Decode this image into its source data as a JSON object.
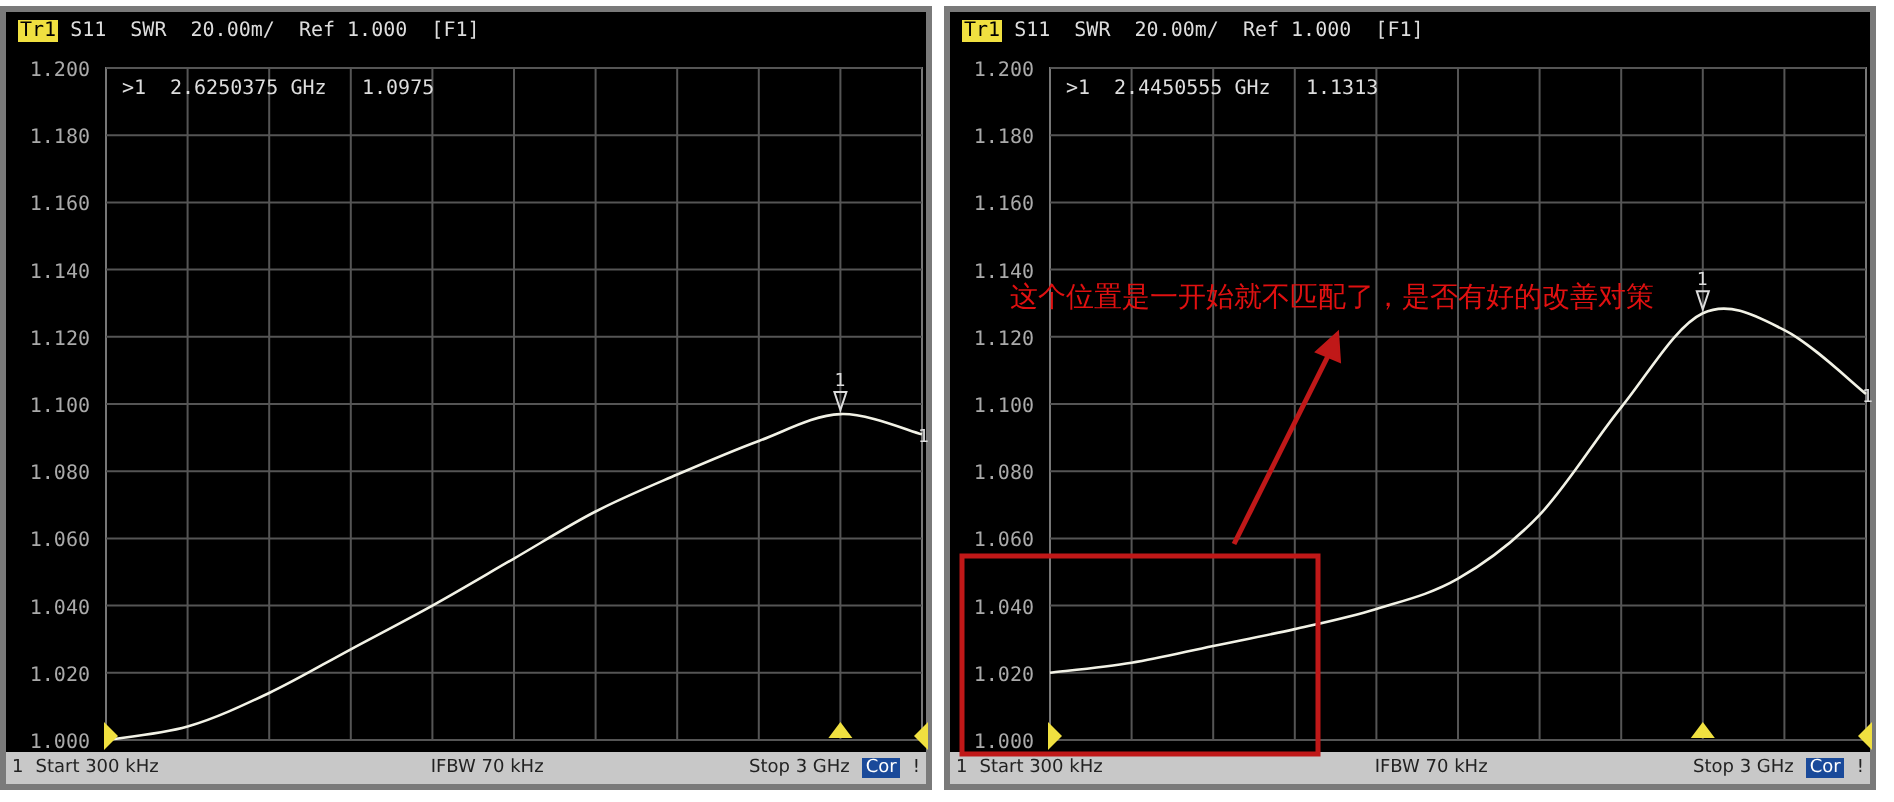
{
  "panels": [
    {
      "trace": "Tr1",
      "header": "S11  SWR  20.00m/  Ref 1.000  [F1]",
      "marker": {
        "label": ">1",
        "frequency": "2.6250375 GHz",
        "value": "1.0975"
      },
      "trace_end_label": "1",
      "chart_data": {
        "type": "line",
        "categories": [
          null,
          null,
          null,
          null,
          null,
          null,
          null,
          null,
          null,
          null,
          null
        ],
        "grid": true,
        "series": [
          {
            "color": "#f2f2e6",
            "values": [
              1.0,
              1.004,
              1.014,
              1.027,
              1.04,
              1.054,
              1.068,
              1.079,
              1.089,
              1.097,
              1.091
            ]
          }
        ],
        "ylim": [
          1.0,
          1.2
        ],
        "yticks": [
          {
            "value": 1.2,
            "label": "1.200"
          },
          {
            "value": 1.18,
            "label": "1.180"
          },
          {
            "value": 1.16,
            "label": "1.160"
          },
          {
            "value": 1.14,
            "label": "1.140"
          },
          {
            "value": 1.12,
            "label": "1.120"
          },
          {
            "value": 1.1,
            "label": "1.100"
          },
          {
            "value": 1.08,
            "label": "1.080"
          },
          {
            "value": 1.06,
            "label": "1.060"
          },
          {
            "value": 1.04,
            "label": "1.040"
          },
          {
            "value": 1.02,
            "label": "1.020"
          },
          {
            "value": 1.0,
            "label": "1.000"
          }
        ],
        "annotations": [
          {
            "text": "1"
          }
        ]
      },
      "status_bar": {
        "channel": "1",
        "start": "Start 300 kHz",
        "ifbw": "IFBW 70 kHz",
        "stop": "Stop 3 GHz",
        "correction": "Cor",
        "alert": "!"
      }
    },
    {
      "trace": "Tr1",
      "header": "S11  SWR  20.00m/  Ref 1.000  [F1]",
      "marker": {
        "label": ">1",
        "frequency": "2.4450555 GHz",
        "value": "1.1313"
      },
      "trace_end_label": "1",
      "chart_data": {
        "type": "line",
        "categories": [
          null,
          null,
          null,
          null,
          null,
          null,
          null,
          null,
          null,
          null,
          null
        ],
        "grid": true,
        "series": [
          {
            "color": "#f2f2e6",
            "values": [
              1.02,
              1.023,
              1.028,
              1.033,
              1.039,
              1.048,
              1.067,
              1.099,
              1.127,
              1.122,
              1.103
            ]
          }
        ],
        "ylim": [
          1.0,
          1.2
        ],
        "yticks": [
          {
            "value": 1.2,
            "label": "1.200"
          },
          {
            "value": 1.18,
            "label": "1.180"
          },
          {
            "value": 1.16,
            "label": "1.160"
          },
          {
            "value": 1.14,
            "label": "1.140"
          },
          {
            "value": 1.12,
            "label": "1.120"
          },
          {
            "value": 1.1,
            "label": "1.100"
          },
          {
            "value": 1.08,
            "label": "1.080"
          },
          {
            "value": 1.06,
            "label": "1.060"
          },
          {
            "value": 1.04,
            "label": "1.040"
          },
          {
            "value": 1.02,
            "label": "1.020"
          },
          {
            "value": 1.0,
            "label": "1.000"
          }
        ],
        "annotations": [
          {
            "text": "1"
          }
        ]
      },
      "status_bar": {
        "channel": "1",
        "start": "Start 300 kHz",
        "ifbw": "IFBW 70 kHz",
        "stop": "Stop 3 GHz",
        "correction": "Cor",
        "alert": "!"
      },
      "note": {
        "text": "这个位置是一开始就不匹配了，是否有好的改善对策"
      }
    }
  ]
}
